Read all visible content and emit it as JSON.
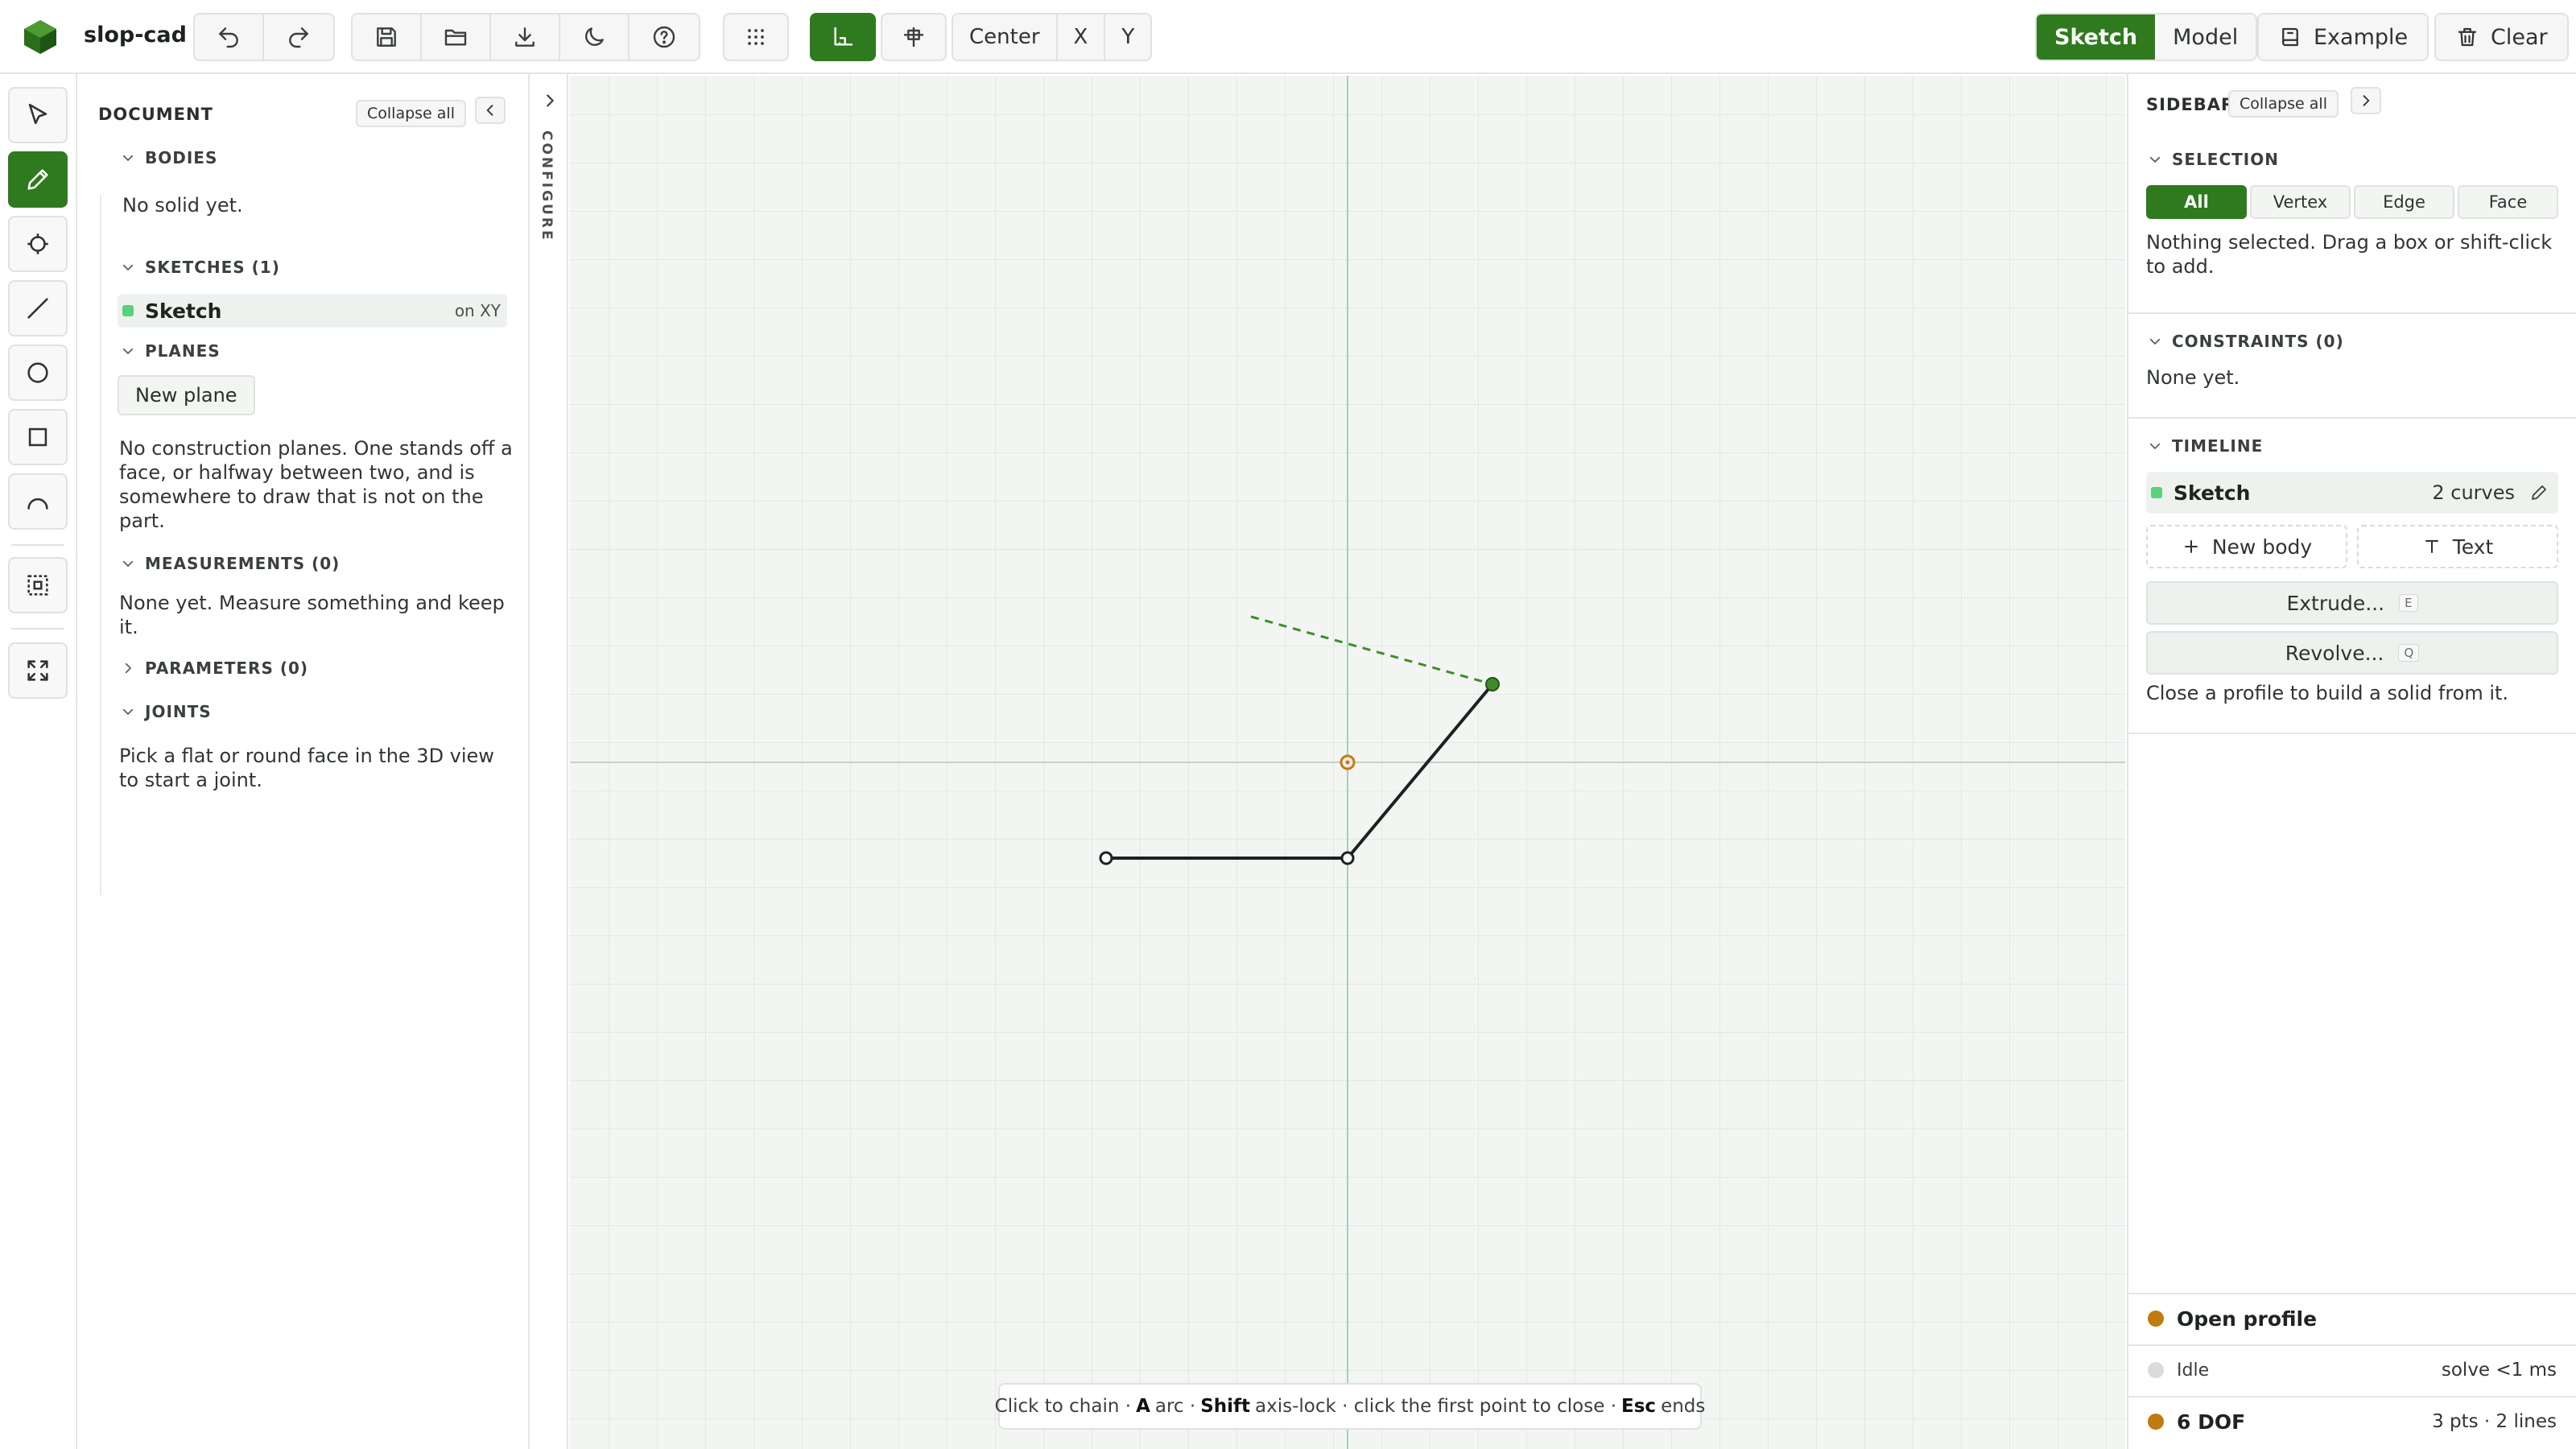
{
  "app": {
    "name": "slop-cad"
  },
  "toolbar": {
    "origin_label": "Center",
    "axis_x": "X",
    "axis_y": "Y",
    "mode_sketch": "Sketch",
    "mode_model": "Model",
    "example_label": "Example",
    "clear_label": "Clear",
    "icons": [
      "undo-icon",
      "redo-icon",
      "save-icon",
      "folder-open-icon",
      "download-icon",
      "moon-icon",
      "help-icon",
      "grid-dots-icon",
      "snap-corner-icon",
      "align-plane-icon",
      "book-icon",
      "trash-icon"
    ]
  },
  "tools": [
    "select-icon",
    "pencil-icon",
    "point-icon",
    "line-icon",
    "circle-icon",
    "rectangle-icon",
    "arc-icon",
    "region-icon",
    "fit-view-icon"
  ],
  "document": {
    "title": "DOCUMENT",
    "collapse_all": "Collapse all",
    "bodies": {
      "heading": "BODIES",
      "empty": "No solid yet."
    },
    "sketches": {
      "heading": "SKETCHES (1)",
      "item_name": "Sketch",
      "item_plane": "on XY",
      "item_color": "#5ad17a"
    },
    "planes": {
      "heading": "PLANES",
      "new_plane": "New plane",
      "empty": "No construction planes. One stands off a face, or halfway between two, and is somewhere to draw that is not on the part."
    },
    "measurements": {
      "heading": "MEASUREMENTS (0)",
      "empty": "None yet. Measure something and keep it."
    },
    "parameters": {
      "heading": "PARAMETERS (0)"
    },
    "joints": {
      "heading": "JOINTS",
      "empty": "Pick a flat or round face in the 3D view to start a joint."
    }
  },
  "configure": {
    "label": "CONFIGURE"
  },
  "canvas": {
    "hint_1": "Click to chain ·",
    "hint_key_a": "A",
    "hint_2": "arc ·",
    "hint_key_shift": "Shift",
    "hint_3": "axis-lock · click the first point to close ·",
    "hint_key_esc": "Esc",
    "hint_4": "ends",
    "colors": {
      "line": "#1d2120",
      "preview": "#3f8d2a",
      "origin": "#c47a12",
      "grid": "#dfe3df"
    }
  },
  "sidebar": {
    "title": "SIDEBAR",
    "collapse_all": "Collapse all",
    "selection": {
      "heading": "SELECTION",
      "tabs": [
        "All",
        "Vertex",
        "Edge",
        "Face"
      ],
      "active": "All",
      "empty": "Nothing selected. Drag a box or shift-click to add."
    },
    "constraints": {
      "heading": "CONSTRAINTS (0)",
      "empty": "None yet."
    },
    "timeline": {
      "heading": "TIMELINE",
      "item_name": "Sketch",
      "item_count": "2 curves",
      "new_body": "New body",
      "text": "Text",
      "extrude": "Extrude...",
      "extrude_key": "E",
      "revolve": "Revolve...",
      "revolve_key": "Q",
      "note": "Close a profile to build a solid from it."
    },
    "status": {
      "profile": "Open profile",
      "profile_color": "#c07a10",
      "idle": "Idle",
      "idle_color": "#d9dcd9",
      "solve": "solve <1 ms",
      "dof": "6 DOF",
      "dof_color": "#c07a10",
      "counts": "3 pts · 2 lines"
    }
  }
}
